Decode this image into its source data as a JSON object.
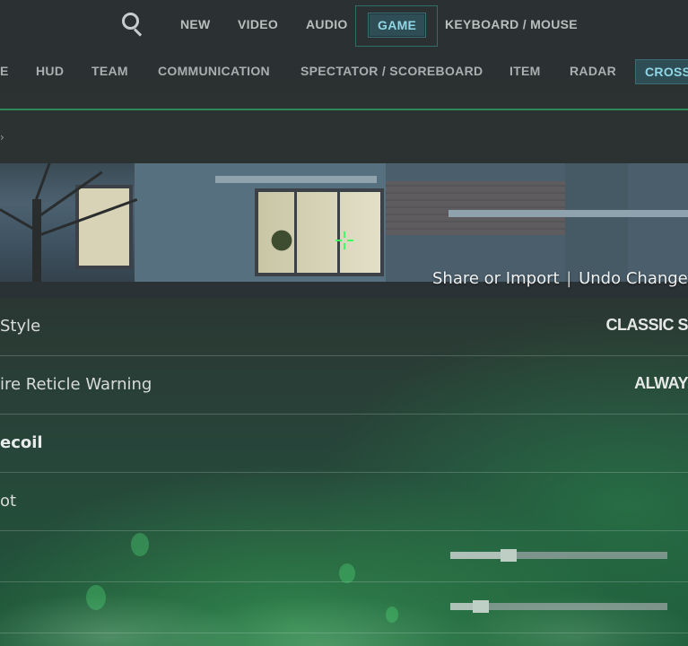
{
  "top_nav": {
    "search_icon": "search-icon",
    "tabs": [
      {
        "label": "NEW",
        "active": false
      },
      {
        "label": "VIDEO",
        "active": false
      },
      {
        "label": "AUDIO",
        "active": false
      },
      {
        "label": "GAME",
        "active": true
      },
      {
        "label": "KEYBOARD / MOUSE",
        "active": false
      }
    ]
  },
  "sub_nav": {
    "tabs": [
      {
        "label": "E",
        "active": false
      },
      {
        "label": "HUD",
        "active": false
      },
      {
        "label": "TEAM",
        "active": false
      },
      {
        "label": "COMMUNICATION",
        "active": false
      },
      {
        "label": "SPECTATOR / SCOREBOARD",
        "active": false
      },
      {
        "label": "ITEM",
        "active": false
      },
      {
        "label": "RADAR",
        "active": false
      },
      {
        "label": "CROSS",
        "active": true
      }
    ]
  },
  "preview": {
    "share_import": "Share or Import",
    "separator": "|",
    "undo": "Undo Change"
  },
  "settings": [
    {
      "label": "Style",
      "value": "CLASSIC S"
    },
    {
      "label": "ire Reticle Warning",
      "value": "ALWAY"
    },
    {
      "label": "ecoil",
      "value": ""
    },
    {
      "label": "ot",
      "value": ""
    }
  ],
  "sliders": [
    {
      "value_fraction": 0.27
    },
    {
      "value_fraction": 0.14
    }
  ],
  "colors": {
    "active_tab_text": "#8fd7e6",
    "crosshair": "#3cff62"
  }
}
